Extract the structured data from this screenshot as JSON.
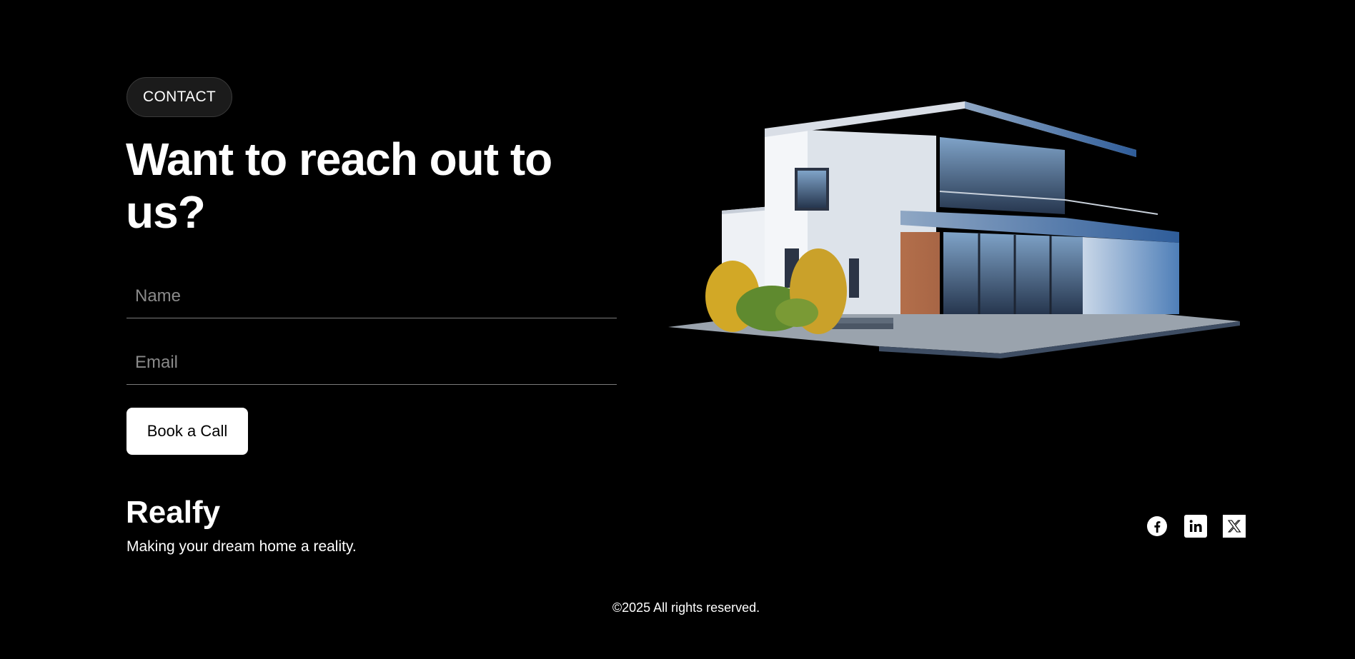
{
  "contact": {
    "badge": "CONTACT",
    "heading": "Want to reach out to us?",
    "name_placeholder": "Name",
    "email_placeholder": "Email",
    "button_label": "Book a Call"
  },
  "footer": {
    "brand": "Realfy",
    "tagline": "Making your dream home a reality.",
    "social": [
      "facebook-icon",
      "linkedin-icon",
      "x-icon"
    ],
    "copyright": "©2025 All rights reserved."
  },
  "colors": {
    "background": "#000000",
    "text": "#ffffff",
    "badge_bg": "#1b1b1b",
    "button_bg": "#ffffff"
  }
}
